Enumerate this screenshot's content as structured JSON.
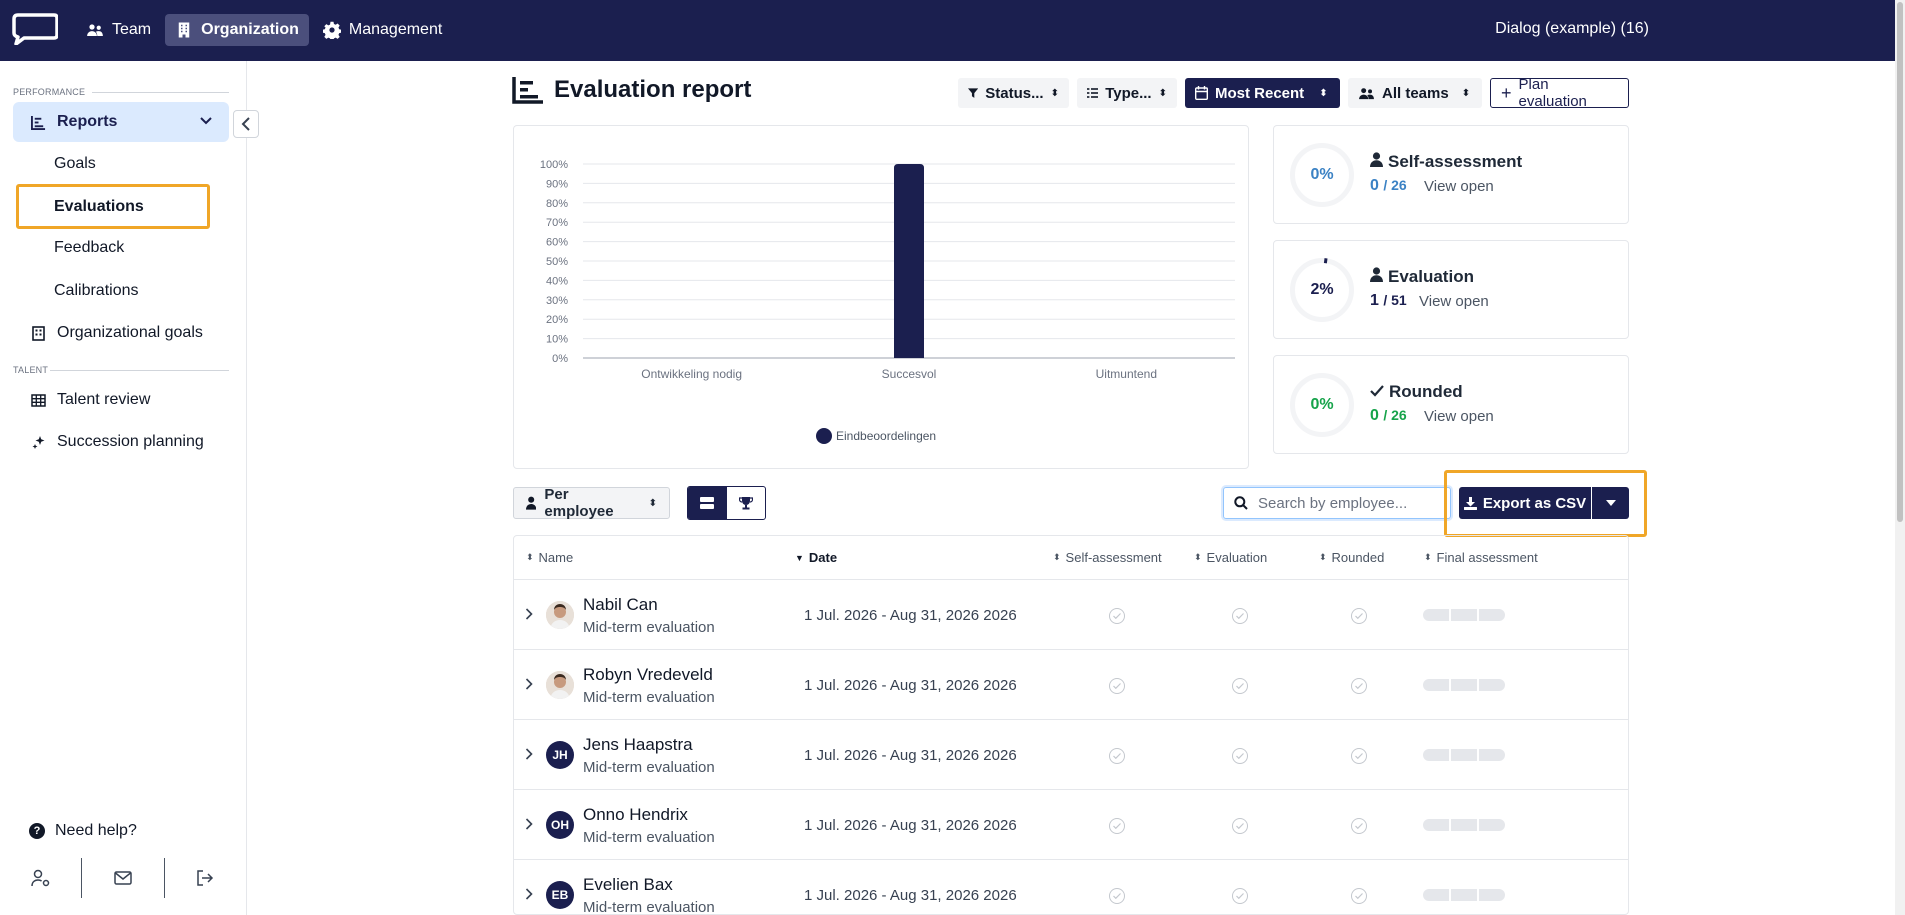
{
  "topbar": {
    "nav": [
      {
        "label": "Team",
        "icon": "users-icon"
      },
      {
        "label": "Organization",
        "icon": "building-icon",
        "active": true
      },
      {
        "label": "Management",
        "icon": "gear-icon"
      }
    ],
    "workspace": "Dialog (example) (16)"
  },
  "sidebar": {
    "performance_label": "PERFORMANCE",
    "talent_label": "TALENT",
    "reports": "Reports",
    "goals": "Goals",
    "evaluations": "Evaluations",
    "feedback": "Feedback",
    "calibrations": "Calibrations",
    "org_goals": "Organizational goals",
    "talent_review": "Talent review",
    "succession": "Succession planning",
    "help": "Need help?"
  },
  "header": {
    "title": "Evaluation report",
    "filters": {
      "status": "Status...",
      "type": "Type...",
      "sort": "Most Recent",
      "teams": "All teams",
      "plan": "Plan evaluation"
    }
  },
  "chart_data": {
    "type": "bar",
    "categories": [
      "Ontwikkeling nodig",
      "Succesvol",
      "Uitmuntend"
    ],
    "series": [
      {
        "name": "Eindbeoordelingen",
        "values": [
          0,
          100,
          0
        ],
        "color": "#1b1f4f"
      }
    ],
    "ylim": [
      0,
      100
    ],
    "yticks": [
      "0%",
      "10%",
      "20%",
      "30%",
      "40%",
      "50%",
      "60%",
      "70%",
      "80%",
      "90%",
      "100%"
    ],
    "legend": "bottom-center",
    "grid": true
  },
  "stats": [
    {
      "percent": "0%",
      "title": "Self-assessment",
      "done": "0",
      "total": "26",
      "link": "View open",
      "color": "#3b82c4",
      "icon": "user-icon",
      "progress": 0
    },
    {
      "percent": "2%",
      "title": "Evaluation",
      "done": "1",
      "total": "51",
      "link": "View open",
      "color": "#1b1f4f",
      "icon": "user-tie-icon",
      "progress": 0.02
    },
    {
      "percent": "0%",
      "title": "Rounded",
      "done": "0",
      "total": "26",
      "link": "View open",
      "color": "#16a34a",
      "icon": "check-icon",
      "progress": 0
    }
  ],
  "toolbar": {
    "group_by": "Per employee",
    "search_placeholder": "Search by employee...",
    "export": "Export as CSV"
  },
  "table": {
    "columns": [
      "Name",
      "Date",
      "Self-assessment",
      "Evaluation",
      "Rounded",
      "Final assessment"
    ],
    "rows": [
      {
        "name": "Nabil Can",
        "type": "Mid-term evaluation",
        "date": "1 Jul. 2026 - Aug 31, 2026 2026",
        "initials": ""
      },
      {
        "name": "Robyn Vredeveld",
        "type": "Mid-term evaluation",
        "date": "1 Jul. 2026 - Aug 31, 2026 2026",
        "initials": ""
      },
      {
        "name": "Jens Haapstra",
        "type": "Mid-term evaluation",
        "date": "1 Jul. 2026 - Aug 31, 2026 2026",
        "initials": "JH"
      },
      {
        "name": "Onno Hendrix",
        "type": "Mid-term evaluation",
        "date": "1 Jul. 2026 - Aug 31, 2026 2026",
        "initials": "OH"
      },
      {
        "name": "Evelien Bax",
        "type": "Mid-term evaluation",
        "date": "1 Jul. 2026 - Aug 31, 2026 2026",
        "initials": "EB"
      }
    ]
  }
}
